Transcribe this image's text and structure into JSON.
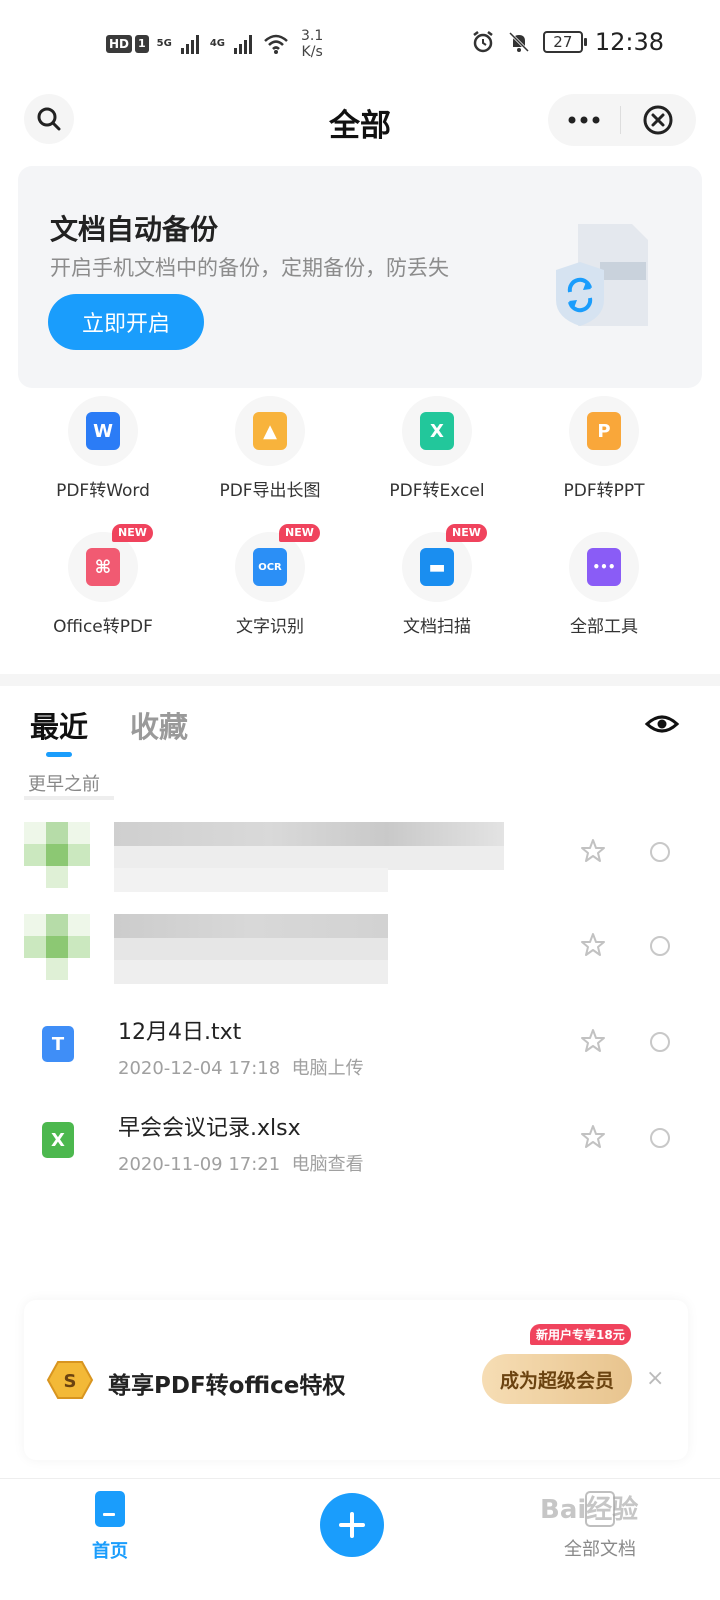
{
  "status_bar": {
    "hd": "HD",
    "sim": "1",
    "net1": "5G",
    "net2": "4G",
    "speed_value": "3.1",
    "speed_unit": "K/s",
    "battery": "27",
    "time": "12:38"
  },
  "header": {
    "title": "全部"
  },
  "banner": {
    "title": "文档自动备份",
    "subtitle": "开启手机文档中的备份，定期备份，防丢失",
    "button": "立即开启"
  },
  "tools": [
    {
      "label": "PDF转Word",
      "icon": "word-icon",
      "glyph": "W",
      "color": "#2b7cf6",
      "new": false
    },
    {
      "label": "PDF导出长图",
      "icon": "image-icon",
      "glyph": "▲",
      "color": "#f8b33c",
      "new": false
    },
    {
      "label": "PDF转Excel",
      "icon": "excel-icon",
      "glyph": "X",
      "color": "#22c79b",
      "new": false
    },
    {
      "label": "PDF转PPT",
      "icon": "ppt-icon",
      "glyph": "P",
      "color": "#f9a73a",
      "new": false
    },
    {
      "label": "Office转PDF",
      "icon": "pdf-icon",
      "glyph": "⌘",
      "color": "#f15a72",
      "new": true
    },
    {
      "label": "文字识别",
      "icon": "ocr-icon",
      "glyph": "OCR",
      "color": "#2b8ff6",
      "new": true
    },
    {
      "label": "文档扫描",
      "icon": "scan-icon",
      "glyph": "▬",
      "color": "#1a8ef0",
      "new": true
    },
    {
      "label": "全部工具",
      "icon": "all-tools-icon",
      "glyph": "•••",
      "color": "#8a5cf6",
      "new": false
    }
  ],
  "new_badge": "NEW",
  "tabs": {
    "recent": "最近",
    "favorites": "收藏"
  },
  "section_label": "更早之前",
  "files": [
    {
      "name": "12月4日.txt",
      "date": "2020-12-04 17:18",
      "source": "电脑上传",
      "type": "txt-icon",
      "glyph": "T",
      "color": "#3f8ef7"
    },
    {
      "name": "早会会议记录.xlsx",
      "date": "2020-11-09 17:21",
      "source": "电脑查看",
      "type": "xlsx-icon",
      "glyph": "X",
      "color": "#4cb84e"
    }
  ],
  "promo": {
    "text": "尊享PDF转office特权",
    "button": "成为超级会员",
    "tag": "新用户专享18元",
    "close": "×"
  },
  "bottom_nav": {
    "home": "首页",
    "all_docs": "全部文档"
  },
  "watermark": "Bai经验"
}
